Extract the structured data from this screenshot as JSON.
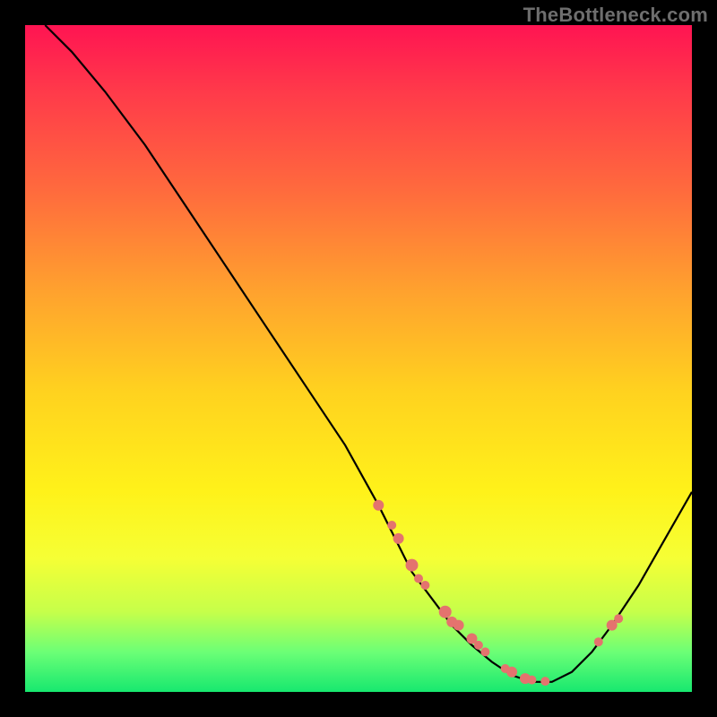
{
  "watermark": "TheBottleneck.com",
  "chart_data": {
    "type": "line",
    "title": "",
    "xlabel": "",
    "ylabel": "",
    "xlim": [
      0,
      100
    ],
    "ylim": [
      0,
      100
    ],
    "series": [
      {
        "name": "bottleneck-curve",
        "x": [
          3,
          7,
          12,
          18,
          24,
          30,
          36,
          42,
          48,
          53,
          56,
          58,
          61,
          64,
          67,
          70,
          73,
          76,
          79,
          82,
          85,
          88,
          92,
          96,
          100
        ],
        "y": [
          100,
          96,
          90,
          82,
          73,
          64,
          55,
          46,
          37,
          28,
          22,
          18,
          14,
          10,
          7,
          4.5,
          2.5,
          1.5,
          1.5,
          3,
          6,
          10,
          16,
          23,
          30
        ]
      }
    ],
    "markers": {
      "name": "highlighted-points",
      "x": [
        53,
        55,
        56,
        58,
        59,
        60,
        63,
        64,
        65,
        67,
        68,
        69,
        72,
        73,
        75,
        76,
        78,
        86,
        88,
        89
      ],
      "y": [
        28,
        25,
        23,
        19,
        17,
        16,
        12,
        10.5,
        10,
        8,
        7,
        6,
        3.5,
        3,
        2,
        1.8,
        1.6,
        7.5,
        10,
        11
      ],
      "r": [
        6,
        5,
        6,
        7,
        5,
        5,
        7,
        6,
        6,
        6,
        5,
        5,
        5,
        6,
        6,
        5,
        5,
        5,
        6,
        5
      ]
    },
    "background_gradient": {
      "stops": [
        {
          "pos": 0,
          "color": "#ff1452"
        },
        {
          "pos": 25,
          "color": "#ff6b3d"
        },
        {
          "pos": 55,
          "color": "#ffd21f"
        },
        {
          "pos": 80,
          "color": "#f5ff35"
        },
        {
          "pos": 100,
          "color": "#17e86f"
        }
      ]
    }
  }
}
